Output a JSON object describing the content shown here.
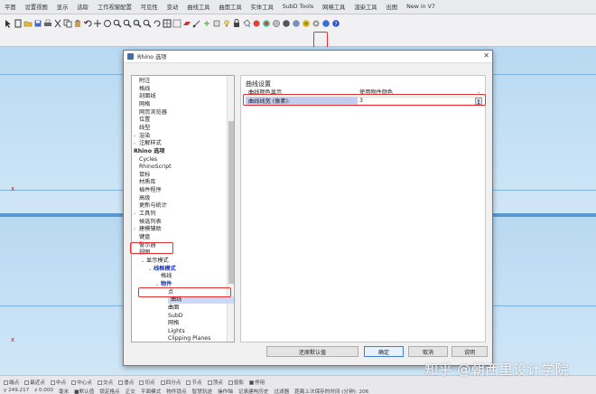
{
  "menu_tabs": [
    "平面",
    "设置视图",
    "显示",
    "选取",
    "工作视窗配置",
    "可见性",
    "变动",
    "曲线工具",
    "曲面工具",
    "实体工具",
    "SubD Tools",
    "网格工具",
    "渲染工具",
    "出图",
    "New in V7"
  ],
  "viewport": {
    "x_marker": "x"
  },
  "dialog": {
    "title": "Rhino 选项",
    "close_glyph": "✕",
    "tree": [
      {
        "label": "附注",
        "indent": 0
      },
      {
        "label": "格线",
        "indent": 0
      },
      {
        "label": "剖面线",
        "indent": 0
      },
      {
        "label": "网格",
        "indent": 0
      },
      {
        "label": "网页浏览器",
        "indent": 0
      },
      {
        "label": "位置",
        "indent": 0
      },
      {
        "label": "线型",
        "indent": 0
      },
      {
        "label": "渲染",
        "indent": 0,
        "arrow": "›"
      },
      {
        "label": "注解样式",
        "indent": 0,
        "arrow": "›"
      },
      {
        "label": "Rhino 选项",
        "indent": -1,
        "bold": true
      },
      {
        "label": "Cycles",
        "indent": 0
      },
      {
        "label": "RhinoScript",
        "indent": 0
      },
      {
        "label": "鼠标",
        "indent": 0
      },
      {
        "label": "材质库",
        "indent": 0
      },
      {
        "label": "插件程序",
        "indent": 0
      },
      {
        "label": "高级",
        "indent": 0
      },
      {
        "label": "更新与统计",
        "indent": 0
      },
      {
        "label": "工具列",
        "indent": 0,
        "arrow": "›"
      },
      {
        "label": "候选列表",
        "indent": 0
      },
      {
        "label": "建模辅助",
        "indent": 0,
        "arrow": "›"
      },
      {
        "label": "键盘",
        "indent": 0
      },
      {
        "label": "警示器",
        "indent": 0
      },
      {
        "label": "视图",
        "indent": 0,
        "arrow": "⌄"
      },
      {
        "label": "显示模式",
        "indent": 1,
        "arrow": "⌄"
      },
      {
        "label": "线框模式",
        "indent": 2,
        "arrow": "⌄",
        "blue": true
      },
      {
        "label": "格线",
        "indent": 3
      },
      {
        "label": "物件",
        "indent": 3,
        "arrow": "⌄",
        "blue": true
      },
      {
        "label": "点",
        "indent": 4
      },
      {
        "label": "曲线",
        "indent": 4,
        "selected": true
      },
      {
        "label": "曲面",
        "indent": 4
      },
      {
        "label": "SubD",
        "indent": 4
      },
      {
        "label": "网格",
        "indent": 4
      },
      {
        "label": "Lights",
        "indent": 4
      },
      {
        "label": "Clipping Planes",
        "indent": 4
      },
      {
        "label": "照明",
        "indent": 3
      }
    ],
    "panel": {
      "title": "曲线设置",
      "rows": [
        {
          "label": "曲线颜色显示",
          "value": "使用物件颜色",
          "control": "dropdown",
          "dropdown_glyph": "⌄"
        },
        {
          "label": "曲线线宽 (像素):",
          "value": "3",
          "control": "stepper",
          "highlighted": true,
          "stepper_up": "▲",
          "stepper_down": "▼"
        }
      ]
    },
    "buttons": {
      "restore": "还原默认值",
      "ok": "确定",
      "cancel": "取消",
      "help": "说明"
    }
  },
  "statusbar": {
    "osnaps": [
      {
        "label": "端点",
        "checked": false
      },
      {
        "label": "最近点",
        "checked": false
      },
      {
        "label": "中点",
        "checked": false
      },
      {
        "label": "中心点",
        "checked": false
      },
      {
        "label": "交点",
        "checked": false
      },
      {
        "label": "垂点",
        "checked": false
      },
      {
        "label": "切点",
        "checked": false
      },
      {
        "label": "四分点",
        "checked": false
      },
      {
        "label": "节点",
        "checked": false
      },
      {
        "label": "顶点",
        "checked": false
      },
      {
        "label": "投影",
        "checked": false
      },
      {
        "label": "停用",
        "checked": true
      }
    ],
    "coords": [
      "y 249.217",
      "z 0.000",
      "毫米",
      "■默认值"
    ],
    "modes": [
      "锁定格点",
      "正交",
      "平面模式",
      "物件锁点",
      "智慧轨迹",
      "操作轴",
      "记录建构历史",
      "过滤器",
      "距离上次保存的时间 (分钟): 206"
    ]
  },
  "watermark": "知乎 @朝西里设计学院"
}
